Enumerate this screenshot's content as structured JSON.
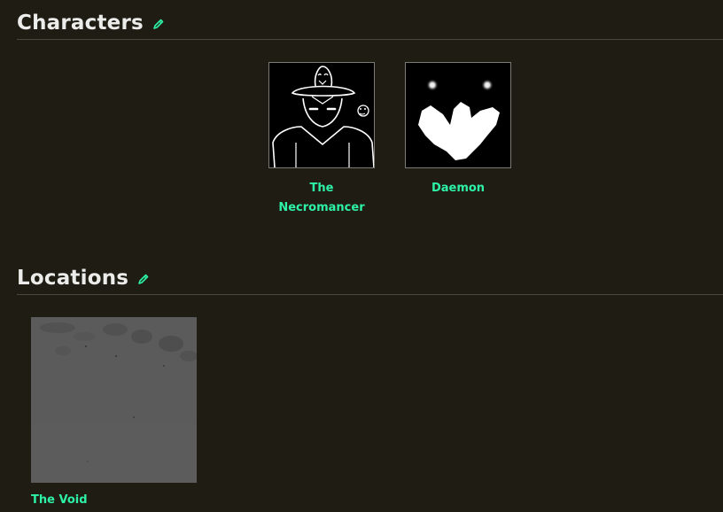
{
  "sections": {
    "characters": {
      "title": "Characters",
      "edit_icon": "pencil-icon",
      "items": [
        {
          "label_line1": "The",
          "label_line2": "Necromancer"
        },
        {
          "label": "Daemon"
        }
      ]
    },
    "locations": {
      "title": "Locations",
      "edit_icon": "pencil-icon",
      "items": [
        {
          "label": "The Void"
        }
      ]
    }
  },
  "colors": {
    "background": "#1f1c14",
    "heading": "#ececea",
    "accent": "#2df2a6",
    "divider": "#4a4740"
  }
}
